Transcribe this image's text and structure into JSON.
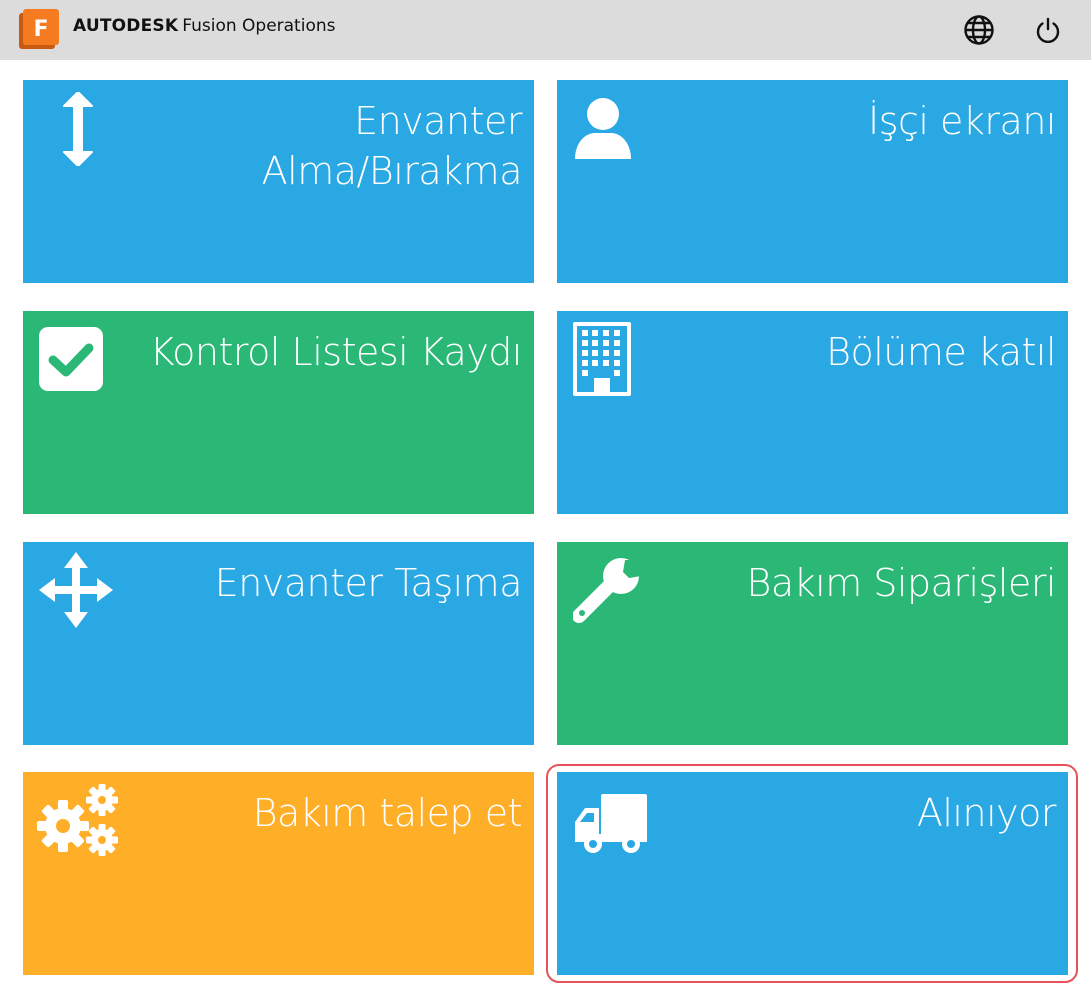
{
  "header": {
    "brand_bold": "AUTODESK",
    "brand_rest": "Fusion Operations",
    "logo_letter": "F",
    "language_icon": "globe-icon",
    "power_icon": "power-icon"
  },
  "colors": {
    "blue": "#29a8e3",
    "green": "#2bb877",
    "orange": "#ffae28",
    "selection": "#e8535b",
    "logo_orange": "#f47b20"
  },
  "tiles": [
    {
      "title": "Envanter Alma/Bırakma",
      "icon": "vertical-arrows-icon",
      "color": "blue"
    },
    {
      "title": "İşçi ekranı",
      "icon": "user-icon",
      "color": "blue"
    },
    {
      "title": "Kontrol Listesi Kaydı",
      "icon": "checkbox-icon",
      "color": "green"
    },
    {
      "title": "Bölüme katıl",
      "icon": "building-icon",
      "color": "blue"
    },
    {
      "title": "Envanter Taşıma",
      "icon": "move-arrows-icon",
      "color": "blue"
    },
    {
      "title": "Bakım Siparişleri",
      "icon": "wrench-icon",
      "color": "green"
    },
    {
      "title": "Bakım talep et",
      "icon": "gears-icon",
      "color": "orange"
    },
    {
      "title": "Alınıyor",
      "icon": "truck-icon",
      "color": "blue",
      "selected": true
    }
  ]
}
